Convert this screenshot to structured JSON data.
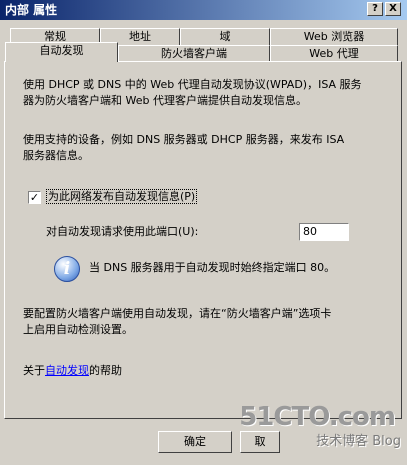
{
  "window": {
    "title": "内部 属性",
    "help_button": "?",
    "close_button": "X"
  },
  "tabs_row1": [
    "常规",
    "地址",
    "域",
    "Web 浏览器"
  ],
  "tabs_row2": [
    "自动发现",
    "防火墙客户端",
    "Web 代理"
  ],
  "active_tab": "自动发现",
  "panel": {
    "intro_line1": "使用 DHCP 或 DNS 中的 Web 代理自动发现协议(WPAD)，ISA 服务",
    "intro_line2": "器为防火墙客户端和 Web 代理客户端提供自动发现信息。",
    "support_line1": "使用支持的设备，例如 DNS 服务器或 DHCP 服务器，来发布 ISA",
    "support_line2": "服务器信息。",
    "publish_checkbox_label": "为此网络发布自动发现信息(P)",
    "publish_checked": true,
    "port_label": "对自动发现请求使用此端口(U):",
    "port_value": "80",
    "info_text": "当 DNS 服务器用于自动发现时始终指定端口 80。",
    "firewall_line1": "要配置防火墙客户端使用自动发现，请在“防火墙客户端”选项卡",
    "firewall_line2": "上启用自动检测设置。",
    "help_prefix": "关于",
    "help_link": "自动发现",
    "help_suffix": "的帮助"
  },
  "buttons": {
    "ok": "确定",
    "cancel": "取"
  },
  "watermark": {
    "main": "51CTO.com",
    "sub": "技术博客 Blog"
  }
}
